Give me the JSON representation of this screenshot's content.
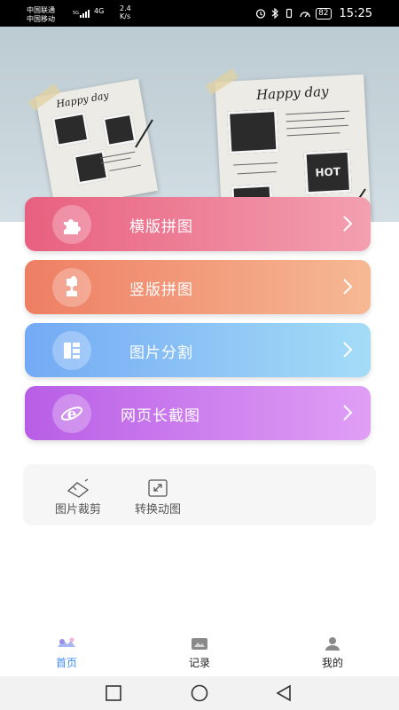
{
  "status_bar": {
    "carrier_1": "中国联通",
    "carrier_2": "中国移动",
    "signal_1_label": "5G",
    "signal_2_label": "4G",
    "network_speed_value": "2.4",
    "network_speed_unit": "K/s",
    "battery_level": "82",
    "time": "15:25"
  },
  "banner": {
    "note_left_heading": "Happy day",
    "note_right_heading": "Happy day",
    "photo_caption": "HOT"
  },
  "menu": [
    {
      "label": "横版拼图",
      "icon": "puzzle-icon",
      "color": "#e86080"
    },
    {
      "label": "竖版拼图",
      "icon": "puzzle-vertical-icon",
      "color": "#ee7e63"
    },
    {
      "label": "图片分割",
      "icon": "grid-split-icon",
      "color": "#73aaf4"
    },
    {
      "label": "网页长截图",
      "icon": "browser-e-icon",
      "color": "#b85ee6"
    }
  ],
  "tools": [
    {
      "label": "图片裁剪",
      "icon": "crop-icon"
    },
    {
      "label": "转换动图",
      "icon": "expand-icon"
    }
  ],
  "bottom_nav": [
    {
      "label": "首页",
      "icon": "home-icon",
      "active": true
    },
    {
      "label": "记录",
      "icon": "record-icon",
      "active": false
    },
    {
      "label": "我的",
      "icon": "profile-icon",
      "active": false
    }
  ],
  "colors": {
    "accent": "#3d8bf2",
    "status_bar_bg": "#000000"
  }
}
